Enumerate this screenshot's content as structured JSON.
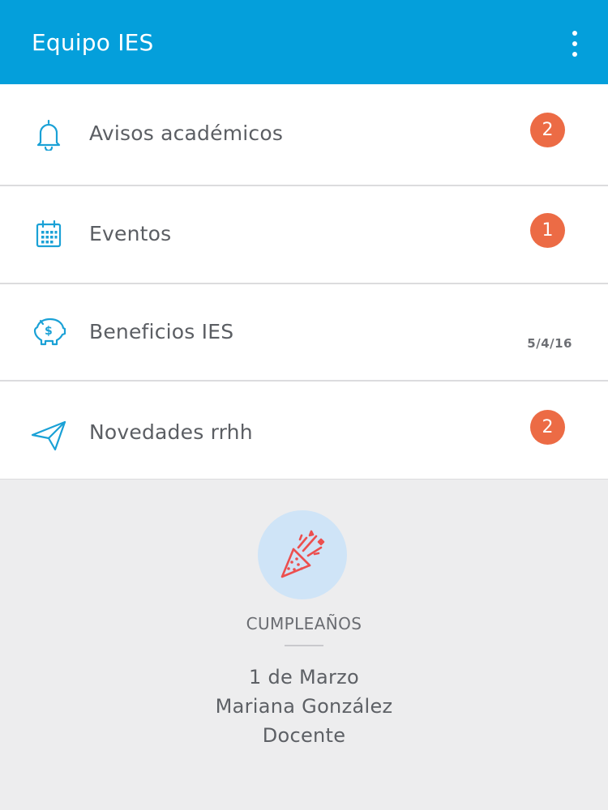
{
  "header": {
    "title": "Equipo IES",
    "background_color": "#049fdb",
    "menu_icon": "more-vertical-icon"
  },
  "menu": [
    {
      "id": "avisos",
      "label": "Avisos académicos",
      "icon": "bell-icon",
      "badge": "2"
    },
    {
      "id": "eventos",
      "label": "Eventos",
      "icon": "calendar-icon",
      "badge": "1"
    },
    {
      "id": "beneficios",
      "label": "Beneficios IES",
      "icon": "piggy-bank-icon",
      "date": "5/4/16"
    },
    {
      "id": "novedades",
      "label": "Novedades rrhh",
      "icon": "paper-plane-icon",
      "badge": "2"
    }
  ],
  "colors": {
    "icon": "#1aa1d6",
    "badge": "#ec6b45",
    "party_icon": "#ec4f4f",
    "party_circle": "#cfe4f7"
  },
  "birthday": {
    "heading": "CUMPLEAÑOS",
    "date": "1 de Marzo",
    "name": "Mariana González",
    "role": "Docente",
    "icon": "party-popper-icon"
  }
}
